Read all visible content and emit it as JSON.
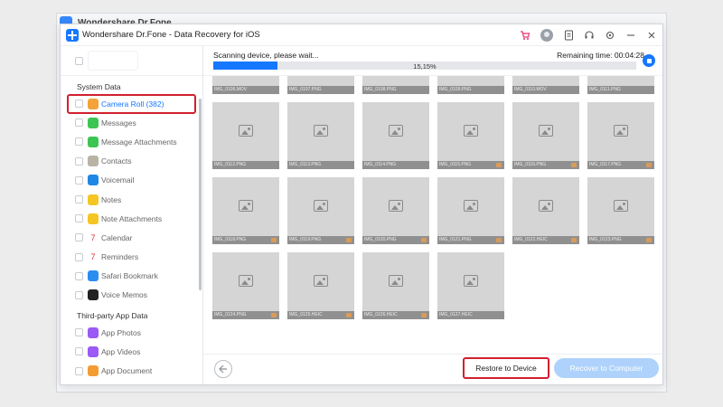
{
  "background_window": {
    "title": "Wondershare Dr.Fone"
  },
  "window": {
    "title": "Wondershare Dr.Fone - Data Recovery for iOS",
    "icons": [
      "cart-icon",
      "account-icon",
      "document-icon",
      "support-icon",
      "settings-icon",
      "minimize-icon",
      "close-icon"
    ]
  },
  "sidebar": {
    "section_system": "System Data",
    "section_third_party": "Third-party App Data",
    "items": [
      {
        "label": "Camera Roll (382)",
        "icon": "camera-roll-icon",
        "color": "#f4a23a"
      },
      {
        "label": "Messages",
        "icon": "messages-icon",
        "color": "#3cc553"
      },
      {
        "label": "Message Attachments",
        "icon": "message-attachments-icon",
        "color": "#3cc553"
      },
      {
        "label": "Contacts",
        "icon": "contacts-icon",
        "color": "#b9b3a6"
      },
      {
        "label": "Voicemail",
        "icon": "voicemail-icon",
        "color": "#1e88e5"
      },
      {
        "label": "Notes",
        "icon": "notes-icon",
        "color": "#f5c623"
      },
      {
        "label": "Note Attachments",
        "icon": "note-attachments-icon",
        "color": "#f5c623"
      },
      {
        "label": "Calendar",
        "icon": "calendar-icon",
        "color": "#ffffff"
      },
      {
        "label": "Reminders",
        "icon": "reminders-icon",
        "color": "#ffffff"
      },
      {
        "label": "Safari Bookmark",
        "icon": "safari-icon",
        "color": "#2a8df0"
      },
      {
        "label": "Voice Memos",
        "icon": "voice-memos-icon",
        "color": "#222222"
      },
      {
        "label": "App Photos",
        "icon": "app-photos-icon",
        "color": "#9b59f5"
      },
      {
        "label": "App Videos",
        "icon": "app-videos-icon",
        "color": "#9b59f5"
      },
      {
        "label": "App Document",
        "icon": "app-document-icon",
        "color": "#f39c33"
      }
    ]
  },
  "progress": {
    "label": "Scanning device, please wait...",
    "percent_text": "15,15%",
    "percent": 15.15,
    "remaining": "Remaining time: 00:04:28"
  },
  "tiles": [
    {
      "kind": "video",
      "cap": "IMG_0106.MOV",
      "tag": false
    },
    {
      "kind": "photo",
      "cap": "IMG_0107.PNG",
      "tag": false
    },
    {
      "kind": "photo",
      "cap": "IMG_0108.PNG",
      "tag": false
    },
    {
      "kind": "photo",
      "cap": "IMG_0109.PNG",
      "tag": false
    },
    {
      "kind": "video",
      "cap": "IMG_0110.MOV",
      "tag": false
    },
    {
      "kind": "photo",
      "cap": "IMG_0111.PNG",
      "tag": false
    },
    {
      "kind": "photo",
      "cap": "IMG_0112.PNG",
      "tag": false
    },
    {
      "kind": "photo",
      "cap": "IMG_0113.PNG",
      "tag": false
    },
    {
      "kind": "photo",
      "cap": "IMG_0114.PNG",
      "tag": false
    },
    {
      "kind": "photo",
      "cap": "IMG_0115.PNG",
      "tag": true
    },
    {
      "kind": "photo",
      "cap": "IMG_0116.PNG",
      "tag": true
    },
    {
      "kind": "photo",
      "cap": "IMG_0117.PNG",
      "tag": true
    },
    {
      "kind": "photo",
      "cap": "IMG_0118.PNG",
      "tag": true
    },
    {
      "kind": "photo",
      "cap": "IMG_0119.PNG",
      "tag": true
    },
    {
      "kind": "photo",
      "cap": "IMG_0120.PNG",
      "tag": true
    },
    {
      "kind": "photo",
      "cap": "IMG_0121.PNG",
      "tag": true
    },
    {
      "kind": "photo",
      "cap": "IMG_0122.HEIC",
      "tag": true
    },
    {
      "kind": "photo",
      "cap": "IMG_0123.PNG",
      "tag": true
    },
    {
      "kind": "photo",
      "cap": "IMG_0124.PNG",
      "tag": true
    },
    {
      "kind": "photo",
      "cap": "IMG_0125.HEIC",
      "tag": true
    },
    {
      "kind": "photo",
      "cap": "IMG_0126.HEIC",
      "tag": true
    },
    {
      "kind": "photo",
      "cap": "IMG_0127.HEIC",
      "tag": false
    }
  ],
  "footer": {
    "restore_label": "Restore to Device",
    "recover_label": "Recover to Computer"
  }
}
